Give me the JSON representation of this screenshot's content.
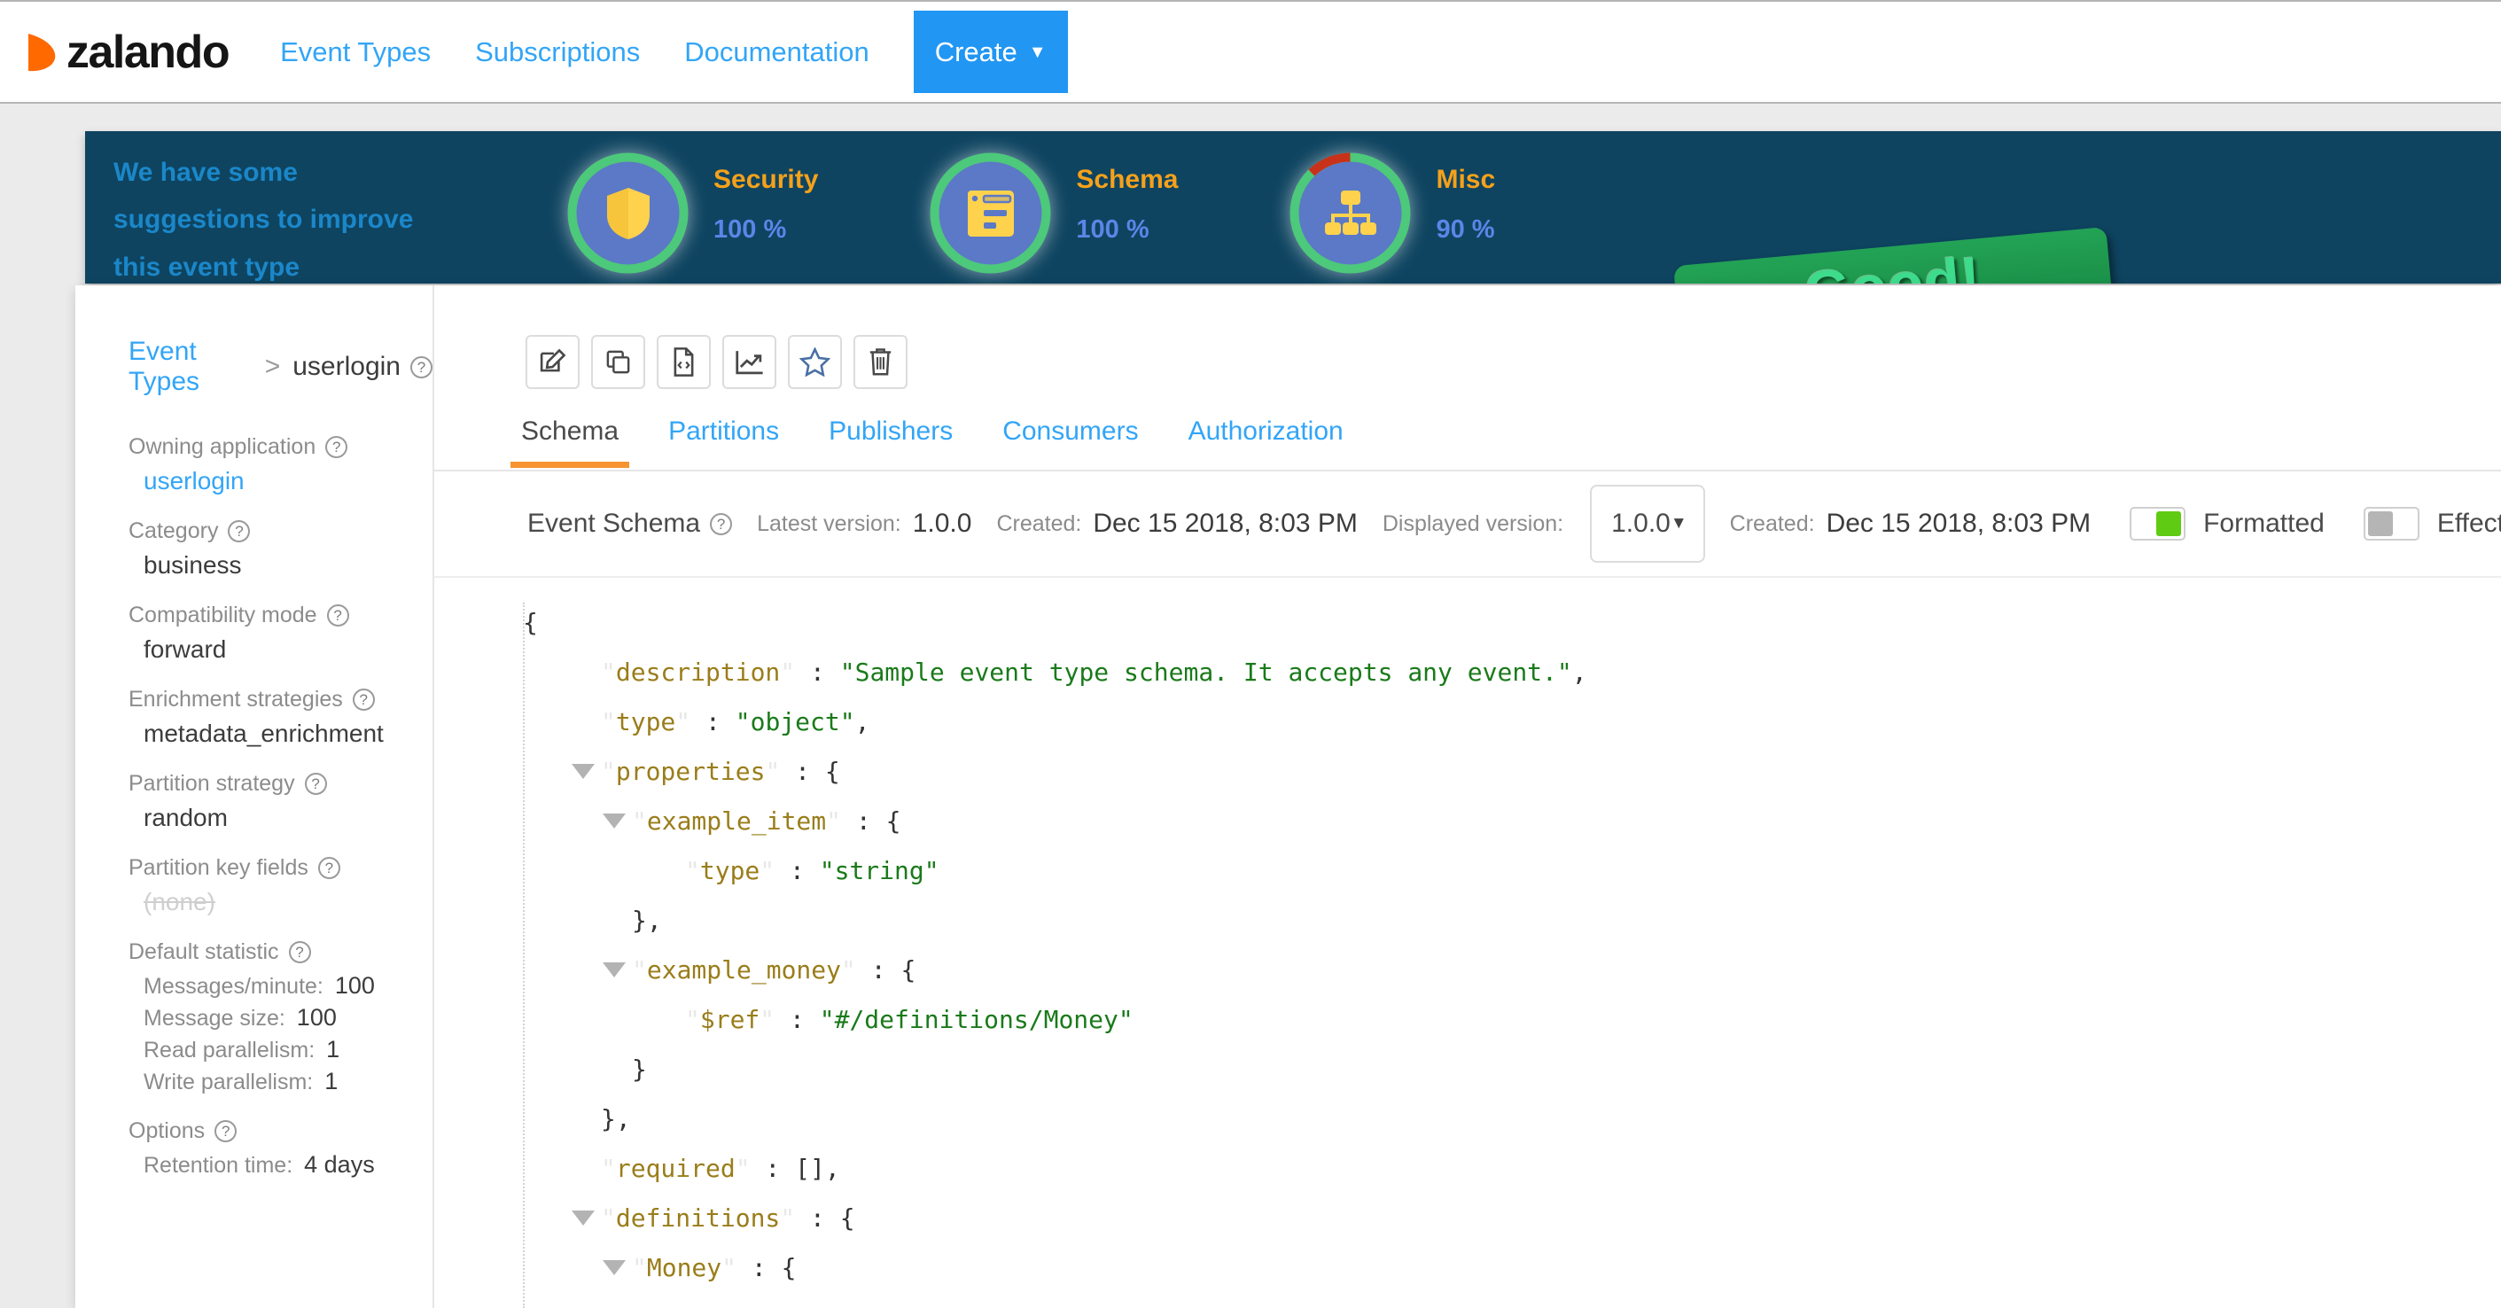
{
  "header": {
    "brand": "zalando",
    "nav": [
      {
        "label": "Event Types"
      },
      {
        "label": "Subscriptions"
      },
      {
        "label": "Documentation"
      }
    ],
    "create_label": "Create",
    "create_caret": "▼"
  },
  "banner": {
    "message": "We have some suggestions to improve this event type configuration.",
    "stamp": "Good!",
    "badges": [
      {
        "name": "Security",
        "percent": "100 %",
        "value": 100,
        "icon": "shield-icon"
      },
      {
        "name": "Schema",
        "percent": "100 %",
        "value": 100,
        "icon": "schema-icon"
      },
      {
        "name": "Misc",
        "percent": "90 %",
        "value": 90,
        "icon": "hierarchy-icon"
      }
    ],
    "colors": {
      "background": "#0e4460",
      "text": "#1b87c9",
      "badge_name": "#f5a11b",
      "badge_percent": "#5b86e8",
      "ring_good": "#4cc97a",
      "ring_bad": "#c8321a",
      "ring_fill": "#5b79c6",
      "icon": "#ffd24d",
      "stamp_bg": "#1b9350",
      "stamp_text": "#3ddb8c"
    }
  },
  "sidebar": {
    "breadcrumb": {
      "root": "Event Types",
      "separator": ">",
      "current": "userlogin",
      "help": "?"
    },
    "fields": [
      {
        "label": "Owning application",
        "value": "userlogin",
        "style": "link"
      },
      {
        "label": "Category",
        "value": "business",
        "style": "plain"
      },
      {
        "label": "Compatibility mode",
        "value": "forward",
        "style": "plain"
      },
      {
        "label": "Enrichment strategies",
        "value": "metadata_enrichment",
        "style": "plain"
      },
      {
        "label": "Partition strategy",
        "value": "random",
        "style": "plain"
      },
      {
        "label": "Partition key fields",
        "value": "(none)",
        "style": "none"
      }
    ],
    "default_statistic": {
      "label": "Default statistic",
      "rows": [
        {
          "key": "Messages/minute:",
          "value": "100"
        },
        {
          "key": "Message size:",
          "value": "100"
        },
        {
          "key": "Read parallelism:",
          "value": "1"
        },
        {
          "key": "Write parallelism:",
          "value": "1"
        }
      ]
    },
    "options": {
      "label": "Options",
      "rows": [
        {
          "key": "Retention time:",
          "value": "4 days"
        }
      ]
    }
  },
  "toolbar": [
    {
      "icon": "edit-icon"
    },
    {
      "icon": "copy-icon"
    },
    {
      "icon": "code-file-icon"
    },
    {
      "icon": "chart-icon"
    },
    {
      "icon": "star-icon"
    },
    {
      "icon": "trash-icon"
    }
  ],
  "tabs": [
    {
      "label": "Schema",
      "active": true
    },
    {
      "label": "Partitions",
      "active": false
    },
    {
      "label": "Publishers",
      "active": false
    },
    {
      "label": "Consumers",
      "active": false
    },
    {
      "label": "Authorization",
      "active": false
    }
  ],
  "schema_bar": {
    "title": "Event Schema",
    "help": "?",
    "latest_version_label": "Latest version:",
    "latest_version": "1.0.0",
    "created_label": "Created:",
    "created_value": "Dec 15 2018, 8:03 PM",
    "displayed_version_label": "Displayed version:",
    "displayed_version": "1.0.0",
    "displayed_caret": "▼",
    "displayed_created_label": "Created:",
    "displayed_created_value": "Dec 15 2018, 8:03 PM",
    "toggles": [
      {
        "label": "Formatted",
        "on": true
      },
      {
        "label": "Effective schema",
        "on": false
      }
    ]
  },
  "code": {
    "lines": [
      {
        "indent": 0,
        "tri": false,
        "parts": [
          {
            "t": "{",
            "c": "p"
          }
        ]
      },
      {
        "indent": 1,
        "tri": false,
        "parts": [
          {
            "t": "\"",
            "c": "q"
          },
          {
            "t": "description",
            "c": "k"
          },
          {
            "t": "\"",
            "c": "q"
          },
          {
            "t": " : ",
            "c": "p"
          },
          {
            "t": "\"Sample event type schema. It accepts any event.\"",
            "c": "s"
          },
          {
            "t": ",",
            "c": "p"
          }
        ]
      },
      {
        "indent": 1,
        "tri": false,
        "parts": [
          {
            "t": "\"",
            "c": "q"
          },
          {
            "t": "type",
            "c": "k"
          },
          {
            "t": "\"",
            "c": "q"
          },
          {
            "t": " : ",
            "c": "p"
          },
          {
            "t": "\"object\"",
            "c": "s"
          },
          {
            "t": ",",
            "c": "p"
          }
        ]
      },
      {
        "indent": 1,
        "tri": true,
        "parts": [
          {
            "t": "\"",
            "c": "q"
          },
          {
            "t": "properties",
            "c": "k"
          },
          {
            "t": "\"",
            "c": "q"
          },
          {
            "t": " : ",
            "c": "p"
          },
          {
            "t": "{",
            "c": "p"
          }
        ]
      },
      {
        "indent": 2,
        "tri": true,
        "parts": [
          {
            "t": "\"",
            "c": "q"
          },
          {
            "t": "example_item",
            "c": "k"
          },
          {
            "t": "\"",
            "c": "q"
          },
          {
            "t": " : ",
            "c": "p"
          },
          {
            "t": "{",
            "c": "p"
          }
        ]
      },
      {
        "indent": 3,
        "tri": false,
        "parts": [
          {
            "t": "\"",
            "c": "q"
          },
          {
            "t": "type",
            "c": "k"
          },
          {
            "t": "\"",
            "c": "q"
          },
          {
            "t": " : ",
            "c": "p"
          },
          {
            "t": "\"string\"",
            "c": "s"
          }
        ]
      },
      {
        "indent": 2,
        "tri": false,
        "parts": [
          {
            "t": "},",
            "c": "p"
          }
        ]
      },
      {
        "indent": 2,
        "tri": true,
        "parts": [
          {
            "t": "\"",
            "c": "q"
          },
          {
            "t": "example_money",
            "c": "k"
          },
          {
            "t": "\"",
            "c": "q"
          },
          {
            "t": " : ",
            "c": "p"
          },
          {
            "t": "{",
            "c": "p"
          }
        ]
      },
      {
        "indent": 3,
        "tri": false,
        "parts": [
          {
            "t": "\"",
            "c": "q"
          },
          {
            "t": "$ref",
            "c": "k"
          },
          {
            "t": "\"",
            "c": "q"
          },
          {
            "t": " : ",
            "c": "p"
          },
          {
            "t": "\"#/definitions/Money\"",
            "c": "s"
          }
        ]
      },
      {
        "indent": 2,
        "tri": false,
        "parts": [
          {
            "t": "}",
            "c": "p"
          }
        ]
      },
      {
        "indent": 1,
        "tri": false,
        "parts": [
          {
            "t": "},",
            "c": "p"
          }
        ]
      },
      {
        "indent": 1,
        "tri": false,
        "parts": [
          {
            "t": "\"",
            "c": "q"
          },
          {
            "t": "required",
            "c": "k"
          },
          {
            "t": "\"",
            "c": "q"
          },
          {
            "t": " : ",
            "c": "p"
          },
          {
            "t": "[],",
            "c": "p"
          }
        ]
      },
      {
        "indent": 1,
        "tri": true,
        "parts": [
          {
            "t": "\"",
            "c": "q"
          },
          {
            "t": "definitions",
            "c": "k"
          },
          {
            "t": "\"",
            "c": "q"
          },
          {
            "t": " : ",
            "c": "p"
          },
          {
            "t": "{",
            "c": "p"
          }
        ]
      },
      {
        "indent": 2,
        "tri": true,
        "parts": [
          {
            "t": "\"",
            "c": "q"
          },
          {
            "t": "Money",
            "c": "k"
          },
          {
            "t": "\"",
            "c": "q"
          },
          {
            "t": " : ",
            "c": "p"
          },
          {
            "t": "{",
            "c": "p"
          }
        ]
      }
    ]
  }
}
